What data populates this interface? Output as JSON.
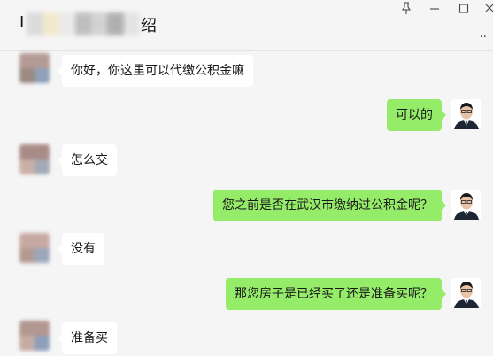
{
  "window": {
    "title_lead": "I",
    "title_tail": "绍",
    "pin_glyph": "⊥",
    "minimize_glyph": "—",
    "maximize_glyph": "☐",
    "close_glyph": "✕",
    "more_glyph": ".."
  },
  "messages": [
    {
      "side": "in",
      "text": "你好，你这里可以代缴公积金嘛"
    },
    {
      "side": "out",
      "text": "可以的"
    },
    {
      "side": "in",
      "text": "怎么交"
    },
    {
      "side": "out",
      "text": "您之前是否在武汉市缴纳过公积金呢？"
    },
    {
      "side": "in",
      "text": "没有"
    },
    {
      "side": "out",
      "text": "那您房子是已经买了还是准备买呢？"
    },
    {
      "side": "in",
      "text": "准备买"
    }
  ],
  "colors": {
    "background": "#f5f5f5",
    "incoming_bubble": "#ffffff",
    "outgoing_bubble": "#95ec69"
  },
  "icons": {
    "pin": "pin-icon",
    "minimize": "minimize-icon",
    "maximize": "maximize-icon",
    "close": "close-icon",
    "contact_avatar": "contact-avatar-blurred",
    "self_avatar": "self-avatar"
  }
}
